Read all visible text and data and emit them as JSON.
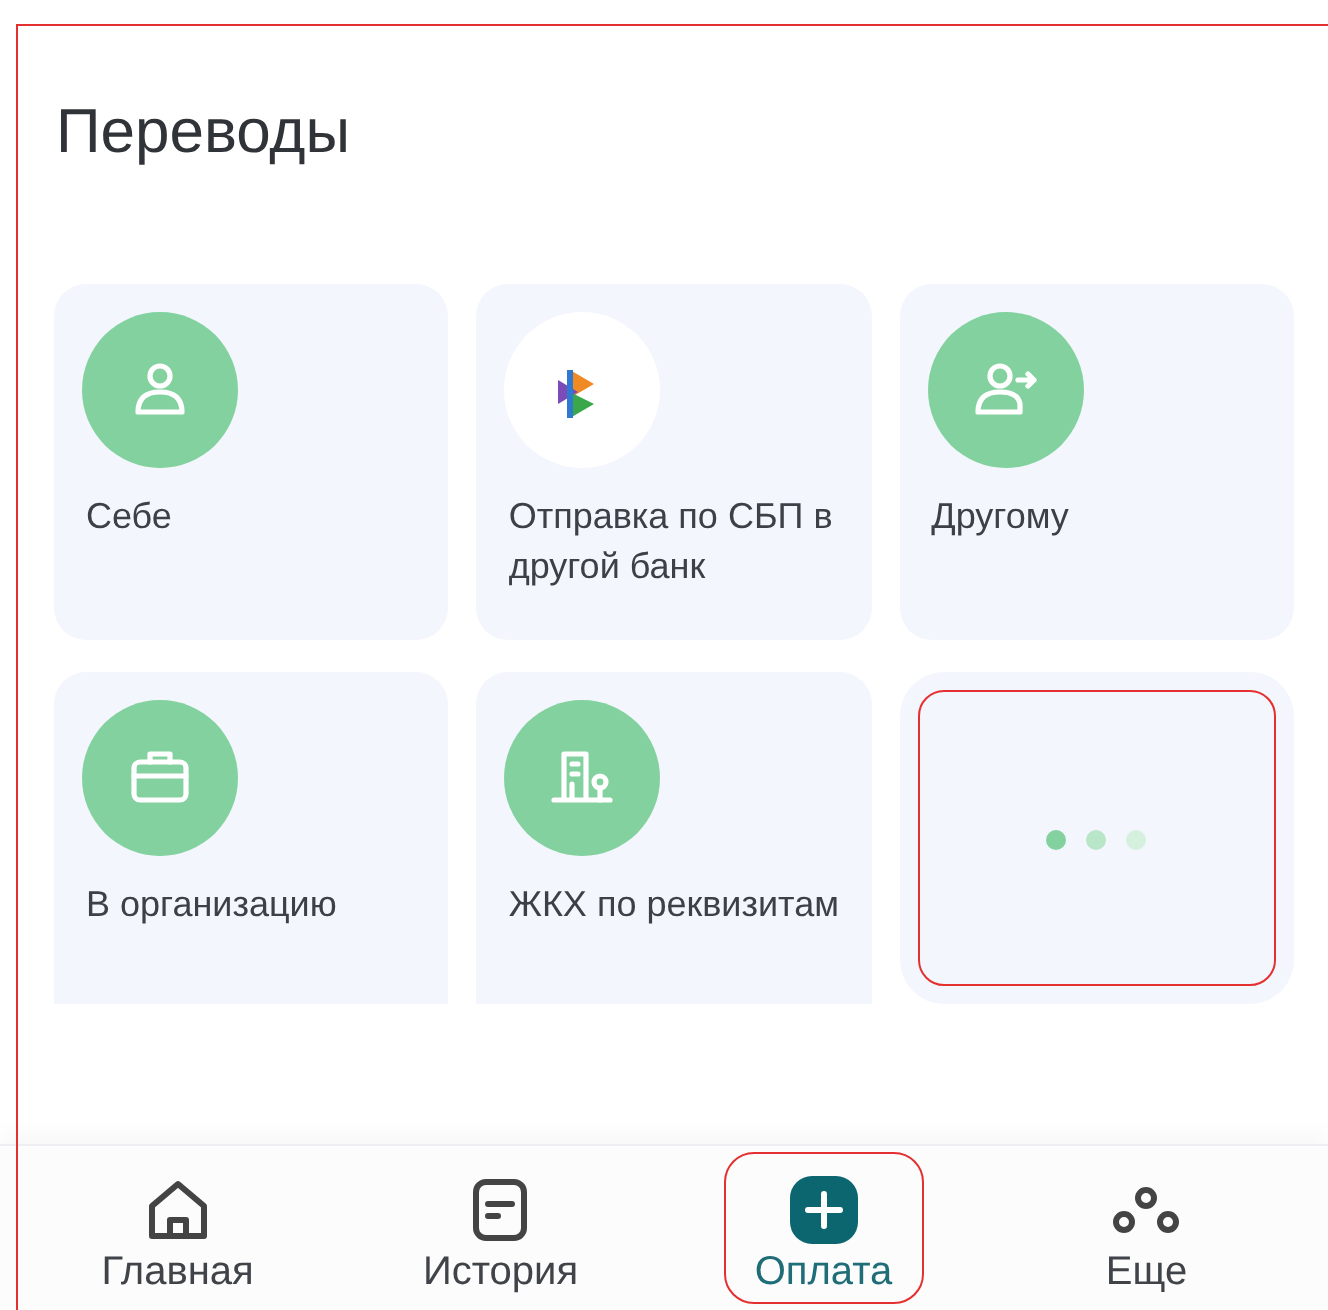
{
  "title": "Переводы",
  "tiles": [
    {
      "kind": "self",
      "label": "Себе",
      "highlighted": false
    },
    {
      "kind": "sbp",
      "label": "Отправка по СБП в другой банк",
      "highlighted": false
    },
    {
      "kind": "other",
      "label": "Другому",
      "highlighted": false
    },
    {
      "kind": "organization",
      "label": "В организацию",
      "highlighted": false
    },
    {
      "kind": "utilities",
      "label": "ЖКХ по реквизитам",
      "highlighted": false
    },
    {
      "kind": "loading",
      "highlighted": true
    }
  ],
  "nav": [
    {
      "kind": "home",
      "label": "Главная",
      "selected": false,
      "highlighted": false
    },
    {
      "kind": "history",
      "label": "История",
      "selected": false,
      "highlighted": false
    },
    {
      "kind": "pay",
      "label": "Оплата",
      "selected": true,
      "highlighted": true
    },
    {
      "kind": "more",
      "label": "Еще",
      "selected": false,
      "highlighted": false
    }
  ]
}
